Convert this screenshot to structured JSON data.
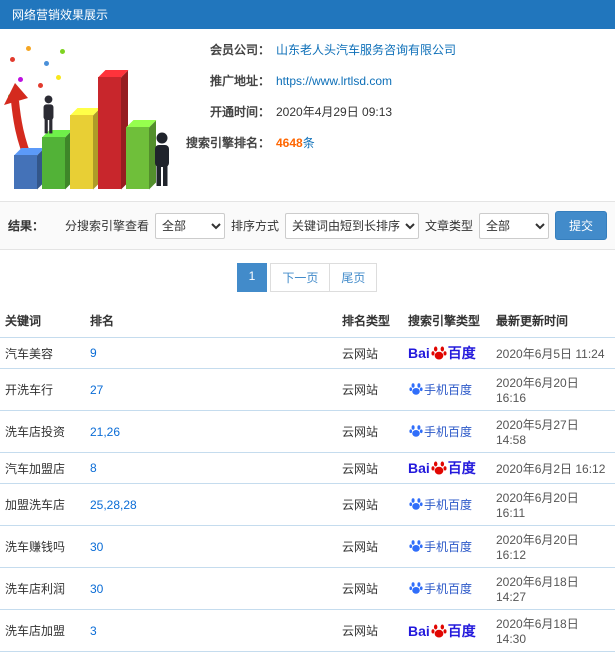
{
  "header": {
    "title": "网络营销效果展示"
  },
  "info": {
    "rows": [
      {
        "label": "会员公司：",
        "value": "山东老人头汽车服务咨询有限公司"
      },
      {
        "label": "推广地址：",
        "value": "https://www.lrtlsd.com"
      },
      {
        "label": "开通时间：",
        "value": "2020年4月29日 09:13"
      }
    ],
    "rank_row": {
      "label": "搜索引擎排名：",
      "count": "4648",
      "unit": "条"
    }
  },
  "results_section": {
    "label": "结果：",
    "filters": [
      {
        "label": "分搜索引擎查看",
        "value": "全部"
      },
      {
        "label": "排序方式",
        "value": "关键词由短到长排序"
      },
      {
        "label": "文章类型",
        "value": "全部"
      }
    ],
    "submit_label": "提交"
  },
  "pagination": {
    "current": "1",
    "next_label": "下一页",
    "last_label": "尾页"
  },
  "table": {
    "headers": [
      "关键词",
      "排名",
      "排名类型",
      "搜索引擎类型",
      "最新更新时间"
    ],
    "engine_labels": {
      "baidu": {
        "prefix": "Bai",
        "suffix": "百度"
      },
      "mobile": {
        "label": "手机百度"
      }
    },
    "rows": [
      {
        "keyword": "汽车美容",
        "rank": "9",
        "rank_type": "云网站",
        "engine": "baidu",
        "updated": "2020年6月5日 11:24"
      },
      {
        "keyword": "开洗车行",
        "rank": "27",
        "rank_type": "云网站",
        "engine": "mobile",
        "updated": "2020年6月20日 16:16"
      },
      {
        "keyword": "洗车店投资",
        "rank": "21,26",
        "rank_type": "云网站",
        "engine": "mobile",
        "updated": "2020年5月27日 14:58"
      },
      {
        "keyword": "汽车加盟店",
        "rank": "8",
        "rank_type": "云网站",
        "engine": "baidu",
        "updated": "2020年6月2日 16:12"
      },
      {
        "keyword": "加盟洗车店",
        "rank": "25,28,28",
        "rank_type": "云网站",
        "engine": "mobile",
        "updated": "2020年6月20日 16:11"
      },
      {
        "keyword": "洗车赚钱吗",
        "rank": "30",
        "rank_type": "云网站",
        "engine": "mobile",
        "updated": "2020年6月20日 16:12"
      },
      {
        "keyword": "洗车店利润",
        "rank": "30",
        "rank_type": "云网站",
        "engine": "mobile",
        "updated": "2020年6月18日 14:27"
      },
      {
        "keyword": "洗车店加盟",
        "rank": "3",
        "rank_type": "云网站",
        "engine": "baidu",
        "updated": "2020年6月18日 14:30"
      }
    ]
  },
  "theme": {
    "header_bg": "#2176bd",
    "link_color": "#0d6fb8",
    "accent_orange": "#ff6600",
    "button_blue": "#428bca",
    "baidu_blue": "#2319dc",
    "baidu_red": "#e10601",
    "mobile_baidu_blue": "#2b58c8",
    "row_border": "#c5dcee"
  }
}
